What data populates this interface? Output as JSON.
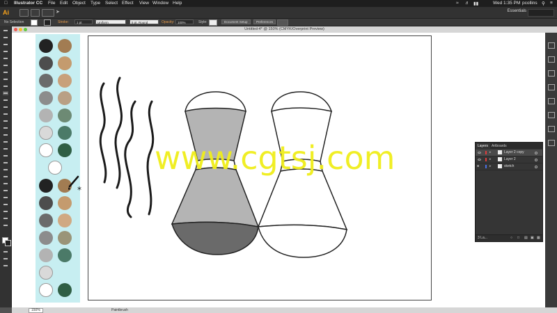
{
  "menubar": {
    "apple": "",
    "app": "Illustrator CC",
    "items": [
      "File",
      "Edit",
      "Object",
      "Type",
      "Select",
      "Effect",
      "View",
      "Window",
      "Help"
    ],
    "clock": "Wed 1:35 PM",
    "user": "pcollins"
  },
  "appbar": {
    "logo": "Ai",
    "workspace": "Essentials"
  },
  "control": {
    "selection": "No Selection",
    "stroke_label": "Stroke:",
    "stroke_weight": "1 pt",
    "profile": "Uniform",
    "brush": "5 pt. Round",
    "opacity_label": "Opacity:",
    "opacity": "100%",
    "style_label": "Style:",
    "doc_setup": "Document Setup",
    "preferences": "Preferences"
  },
  "document": {
    "title": "Untitled-4* @ 150% (CMYK/Overprint Preview)"
  },
  "status": {
    "zoom": "150%",
    "tool": "Paintbrush"
  },
  "swatches": {
    "left_column": [
      "#222222",
      "#4d4d4d",
      "#6b6b6b",
      "#8c8c8c",
      "#b3b3b3",
      "#d9d9d9",
      "#ffffff",
      "#ffffff",
      "#222222",
      "#4d4d4d",
      "#6b6b6b",
      "#8c8c8c",
      "#b3b3b3",
      "#d9d9d9",
      "#ffffff"
    ],
    "right_column": [
      "#a27c52",
      "#c49b6e",
      "#c8a07a",
      "#b9a084",
      "#6d8a74",
      "#4b7a68",
      "#2f5e44",
      "#a27c52",
      "#c49b6e",
      "#d0a982",
      "#9a9478",
      "#4b7a68",
      "#2f5e44"
    ]
  },
  "watermark": "www.cgtsj.com",
  "layers": {
    "tabs": [
      "Layers",
      "Artboards"
    ],
    "rows": [
      {
        "name": "Layer 2 copy",
        "color": "#e03c3c"
      },
      {
        "name": "Layer 2",
        "color": "#e03c3c"
      },
      {
        "name": "sketch",
        "color": "#4a6fe3"
      }
    ],
    "footer": "3 La..."
  },
  "colors": {
    "menubar": "#1e1e1e",
    "app_chrome": "#323232",
    "swatch_panel": "#c7eef1",
    "watermark": "#f0ee1a",
    "shaker_gray": "#b4b4b4",
    "shaker_dark": "#6a6a6a"
  }
}
